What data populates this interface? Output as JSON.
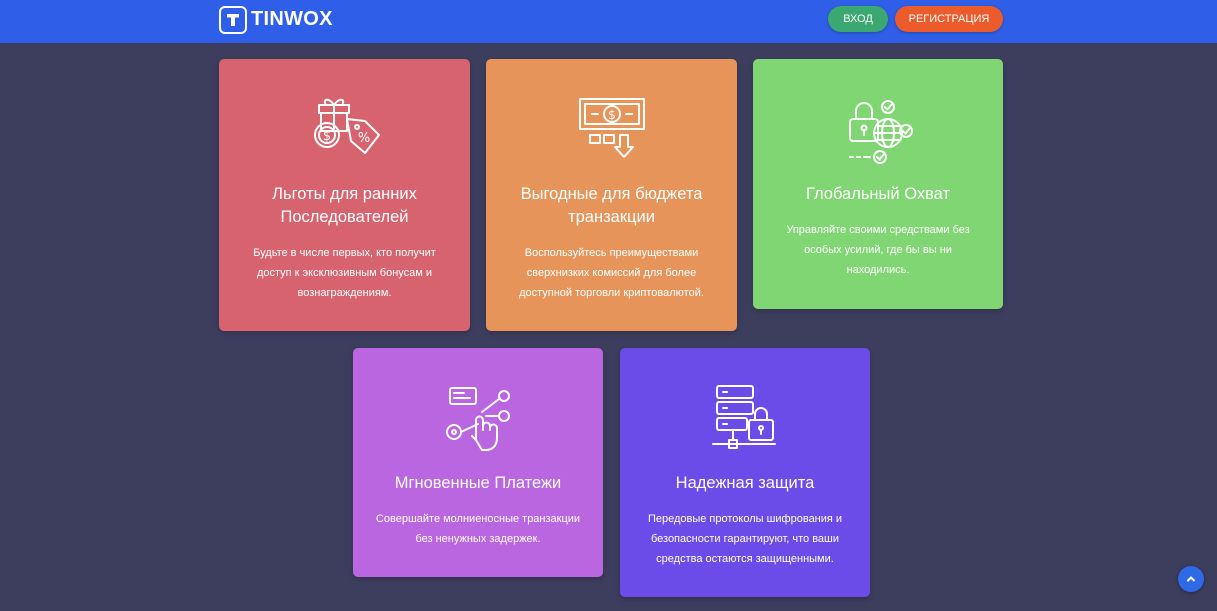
{
  "header": {
    "logo_text": "TINWOX",
    "login_label": "ВХОД",
    "register_label": "РЕГИСТРАЦИЯ"
  },
  "colors": {
    "header": "#2f5fe8",
    "background": "#3d3d5e",
    "login": "#3aa870",
    "register": "#ec5b2c"
  },
  "features": [
    {
      "icon": "gift-discount-icon",
      "title": "Льготы для ранних Последователей",
      "text": "Будьте в числе первых, кто получит доступ к эксклюзивным бонусам и вознаграждениям.",
      "color": "#d6636e"
    },
    {
      "icon": "money-transfer-icon",
      "title": "Выгодные для бюджета транзакции",
      "text": "Воспользуйтесь преимуществами сверхнизких комиссий для более доступной торговли криптовалютой.",
      "color": "#e6945a"
    },
    {
      "icon": "global-security-icon",
      "title": "Глобальный Охват",
      "text": "Управляйте своими средствами без особых усилий, где бы вы ни находились.",
      "color": "#7fd672"
    },
    {
      "icon": "instant-payment-icon",
      "title": "Мгновенные Платежи",
      "text": "Совершайте молниеносные транзакции без ненужных задержек.",
      "color": "#b966e0"
    },
    {
      "icon": "secure-server-icon",
      "title": "Надежная защита",
      "text": "Передовые протоколы шифрования и безопасности гарантируют, что ваши средства остаются защищенными.",
      "color": "#6b4ce8"
    }
  ]
}
